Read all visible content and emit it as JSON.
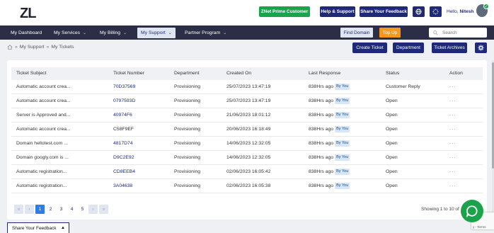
{
  "header": {
    "logo": "ZL",
    "prime_button": "ZNet Prime Customer",
    "help_button": "Help & Support",
    "share_button": "Share Your Feedback",
    "hello_prefix": "Hello,",
    "user_name": "Nitesh"
  },
  "nav": {
    "items": [
      {
        "label": "My Dashboard"
      },
      {
        "label": "My Services"
      },
      {
        "label": "My Billing"
      },
      {
        "label": "My Support"
      },
      {
        "label": "Partner Program"
      }
    ],
    "find_domain": "Find Domain",
    "top_up": "Top Up",
    "search_placeholder": "Search"
  },
  "breadcrumb": {
    "items": [
      "My Support",
      "My Tickets"
    ],
    "separator": "»"
  },
  "actions": {
    "create": "Create Ticket",
    "department": "Department",
    "archives": "Ticket Archives"
  },
  "table": {
    "headers": [
      "Ticket Subject",
      "Ticket Number",
      "Department",
      "Created On",
      "Last Response",
      "Status",
      "Action"
    ],
    "badge": "By You",
    "rows": [
      {
        "subject": "Automatic account crea...",
        "number": "70D37569",
        "department": "Provisioning",
        "created": "25/07/2023 13:47:19",
        "response": "838Hrs ago",
        "status": "Customer Reply",
        "action": "···"
      },
      {
        "subject": "Automatic account crea...",
        "number": "0797593D",
        "department": "Provisioning",
        "created": "25/07/2023 13:47:19",
        "response": "838Hrs ago",
        "status": "Open",
        "action": "···"
      },
      {
        "subject": "Server is Approved and...",
        "number": "40974F6",
        "department": "Provisioning",
        "created": "21/06/2023 18:01:12",
        "response": "838Hrs ago",
        "status": "Open",
        "action": "···"
      },
      {
        "subject": "Automatic account crea...",
        "number": "C58F9EF",
        "department": "Provisioning",
        "created": "20/06/2023 16:18:49",
        "response": "838Hrs ago",
        "status": "Open",
        "action": "···"
      },
      {
        "subject": "Domain hellotest.com ...",
        "number": "4817D74",
        "department": "Provisioning",
        "created": "14/06/2023 12:32:05",
        "response": "838Hrs ago",
        "status": "Open",
        "action": "···"
      },
      {
        "subject": "Domain googly.com is ...",
        "number": "D9C2E92",
        "department": "Provisioning",
        "created": "14/06/2023 12:32:05",
        "response": "838Hrs ago",
        "status": "Open",
        "action": "···"
      },
      {
        "subject": "Automatic registration...",
        "number": "CD8EEB4",
        "department": "Provisioning",
        "created": "02/06/2023 16:05:42",
        "response": "838Hrs ago",
        "status": "Open",
        "action": "···"
      },
      {
        "subject": "Automatic registration...",
        "number": "3A04638",
        "department": "Provisioning",
        "created": "02/06/2023 16:05:38",
        "response": "838Hrs ago",
        "status": "Open",
        "action": "···"
      }
    ]
  },
  "pagination": {
    "first": "«",
    "prev": "‹",
    "pages": [
      "1",
      "2",
      "3",
      "4",
      "5"
    ],
    "next": "›",
    "last": "»",
    "current": "1",
    "showing": "Showing 1 to 10 of"
  },
  "footer": {
    "share_feedback": "Share Your Feedback",
    "recaptcha_terms": "y - Terms"
  },
  "colors": {
    "navy": "#1e2a78",
    "nav_bg": "#2c2e46",
    "green": "#1aa34a",
    "orange": "#f39a1e",
    "active_page": "#2f7de1"
  },
  "icons": [
    "globe-icon",
    "spinner-icon",
    "home-icon",
    "search-icon",
    "gear-icon",
    "chat-icon",
    "chevron-down-icon"
  ]
}
